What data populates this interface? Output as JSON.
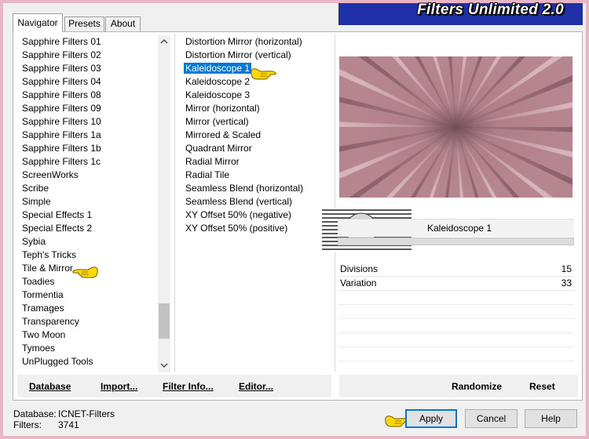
{
  "app": {
    "title": "Filters Unlimited 2.0",
    "accent": "#1e2fa8",
    "selection_color": "#0078d7",
    "frame_color": "#e9b6c6"
  },
  "tabs": [
    {
      "label": "Navigator",
      "active": true
    },
    {
      "label": "Presets",
      "active": false
    },
    {
      "label": "About",
      "active": false
    }
  ],
  "categories": [
    "Sapphire Filters 01",
    "Sapphire Filters 02",
    "Sapphire Filters 03",
    "Sapphire Filters 04",
    "Sapphire Filters 08",
    "Sapphire Filters 09",
    "Sapphire Filters 10",
    "Sapphire Filters 1a",
    "Sapphire Filters 1b",
    "Sapphire Filters 1c",
    "ScreenWorks",
    "Scribe",
    "Simple",
    "Special Effects 1",
    "Special Effects 2",
    "Sybia",
    "Teph's Tricks",
    "Tile & Mirror",
    "Toadies",
    "Tormentia",
    "Tramages",
    "Transparency",
    "Two Moon",
    "Tymoes",
    "UnPlugged Tools"
  ],
  "pointed_category": "Tile & Mirror",
  "filters": [
    "Distortion Mirror (horizontal)",
    "Distortion Mirror (vertical)",
    "Kaleidoscope 1",
    "Kaleidoscope 2",
    "Kaleidoscope 3",
    "Mirror (horizontal)",
    "Mirror (vertical)",
    "Mirrored & Scaled",
    "Quadrant Mirror",
    "Radial Mirror",
    "Radial Tile",
    "Seamless Blend (horizontal)",
    "Seamless Blend (vertical)",
    "XY Offset 50% (negative)",
    "XY Offset 50% (positive)"
  ],
  "selected_filter": "Kaleidoscope 1",
  "params": {
    "title": "Kaleidoscope 1",
    "rows": [
      {
        "name": "Divisions",
        "value": "15"
      },
      {
        "name": "Variation",
        "value": "33"
      }
    ]
  },
  "watermark": {
    "text": "claudia"
  },
  "toolbar": {
    "database_label": "Database",
    "import_label": "Import...",
    "filterinfo_label": "Filter Info...",
    "editor_label": "Editor...",
    "randomize_label": "Randomize",
    "reset_label": "Reset"
  },
  "status": {
    "database_label": "Database:",
    "database_value": "ICNET-Filters",
    "filters_label": "Filters:",
    "filters_value": "3741"
  },
  "buttons": {
    "apply": "Apply",
    "cancel": "Cancel",
    "help": "Help"
  },
  "icons": {
    "pointer": "pointing-hand-icon",
    "scroll_up": "chevron-up-icon",
    "scroll_down": "chevron-down-icon"
  }
}
